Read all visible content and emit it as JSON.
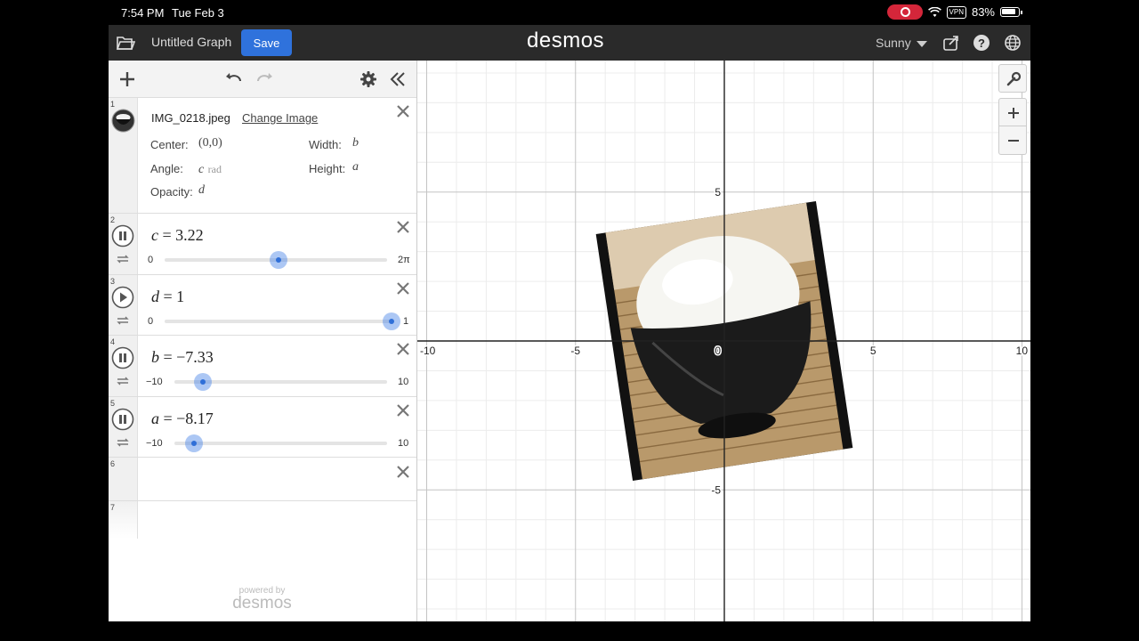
{
  "status": {
    "time": "7:54 PM",
    "date": "Tue Feb 3",
    "vpn": "VPN",
    "battery": "83%"
  },
  "appbar": {
    "title": "Untitled Graph",
    "save_label": "Save",
    "brand": "desmos",
    "user": "Sunny"
  },
  "image_expr": {
    "num": "1",
    "filename": "IMG_0218.jpeg",
    "change_label": "Change Image",
    "center_label": "Center:",
    "center_value": "(0,0)",
    "width_label": "Width:",
    "width_value": "b",
    "angle_label": "Angle:",
    "angle_var": "c",
    "angle_unit": "rad",
    "height_label": "Height:",
    "height_value": "a",
    "opacity_label": "Opacity:",
    "opacity_value": "d"
  },
  "sliders": [
    {
      "num": "2",
      "var": "c",
      "value": "3.22",
      "numeric": 3.22,
      "min_label": "0",
      "max_label": "2π",
      "min": 0,
      "max": 6.2832,
      "playing": true
    },
    {
      "num": "3",
      "var": "d",
      "value": "1",
      "numeric": 1,
      "min_label": "0",
      "max_label": "1",
      "min": 0,
      "max": 1,
      "playing": false
    },
    {
      "num": "4",
      "var": "b",
      "value": "−7.33",
      "numeric": -7.33,
      "min_label": "−10",
      "max_label": "10",
      "min": -10,
      "max": 10,
      "playing": true
    },
    {
      "num": "5",
      "var": "a",
      "value": "−8.17",
      "numeric": -8.17,
      "min_label": "−10",
      "max_label": "10",
      "min": -10,
      "max": 10,
      "playing": true
    }
  ],
  "empty_rows": [
    "6",
    "7"
  ],
  "powered": {
    "small": "powered by",
    "brand": "desmos"
  },
  "graph": {
    "x_range": [
      -10,
      10
    ],
    "tick_labels_x": [
      "-10",
      "-5",
      "0",
      "5",
      "10"
    ],
    "tick_labels_y": [
      "5",
      "-5"
    ],
    "origin_label": "0"
  },
  "colors": {
    "accent": "#2f72dc",
    "appbar": "#2a2a2a",
    "slider": "#2f6fd8"
  },
  "icons": [
    "folder-icon",
    "share-icon",
    "help-icon",
    "globe-icon",
    "plus-icon",
    "undo-icon",
    "redo-icon",
    "gear-icon",
    "collapse-icon",
    "close-icon",
    "pause-icon",
    "play-icon",
    "loop-icon",
    "wrench-icon",
    "zoom-in-icon",
    "zoom-out-icon"
  ]
}
